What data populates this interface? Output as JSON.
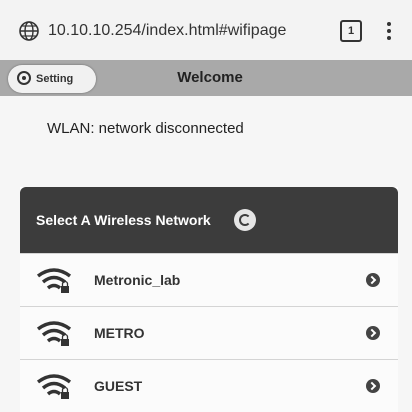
{
  "browser": {
    "url": "10.10.10.254/index.html#wifipage",
    "tab_count": "1",
    "icons": {
      "site": "globe-icon",
      "tabs": "tabs-icon",
      "menu": "more-vert-icon"
    }
  },
  "header": {
    "setting_label": "Setting",
    "title": "Welcome",
    "color": "#a9a9a9"
  },
  "wlan": {
    "status": "WLAN: network disconnected"
  },
  "networks_panel": {
    "title": "Select A Wireless Network",
    "header_color": "#3c3c3c",
    "icons": {
      "refresh": "refresh-icon",
      "item": "wifi-locked-icon",
      "open": "chevron-right-icon"
    },
    "items": [
      {
        "ssid": "Metronic_lab"
      },
      {
        "ssid": "METRO"
      },
      {
        "ssid": "GUEST"
      }
    ]
  }
}
